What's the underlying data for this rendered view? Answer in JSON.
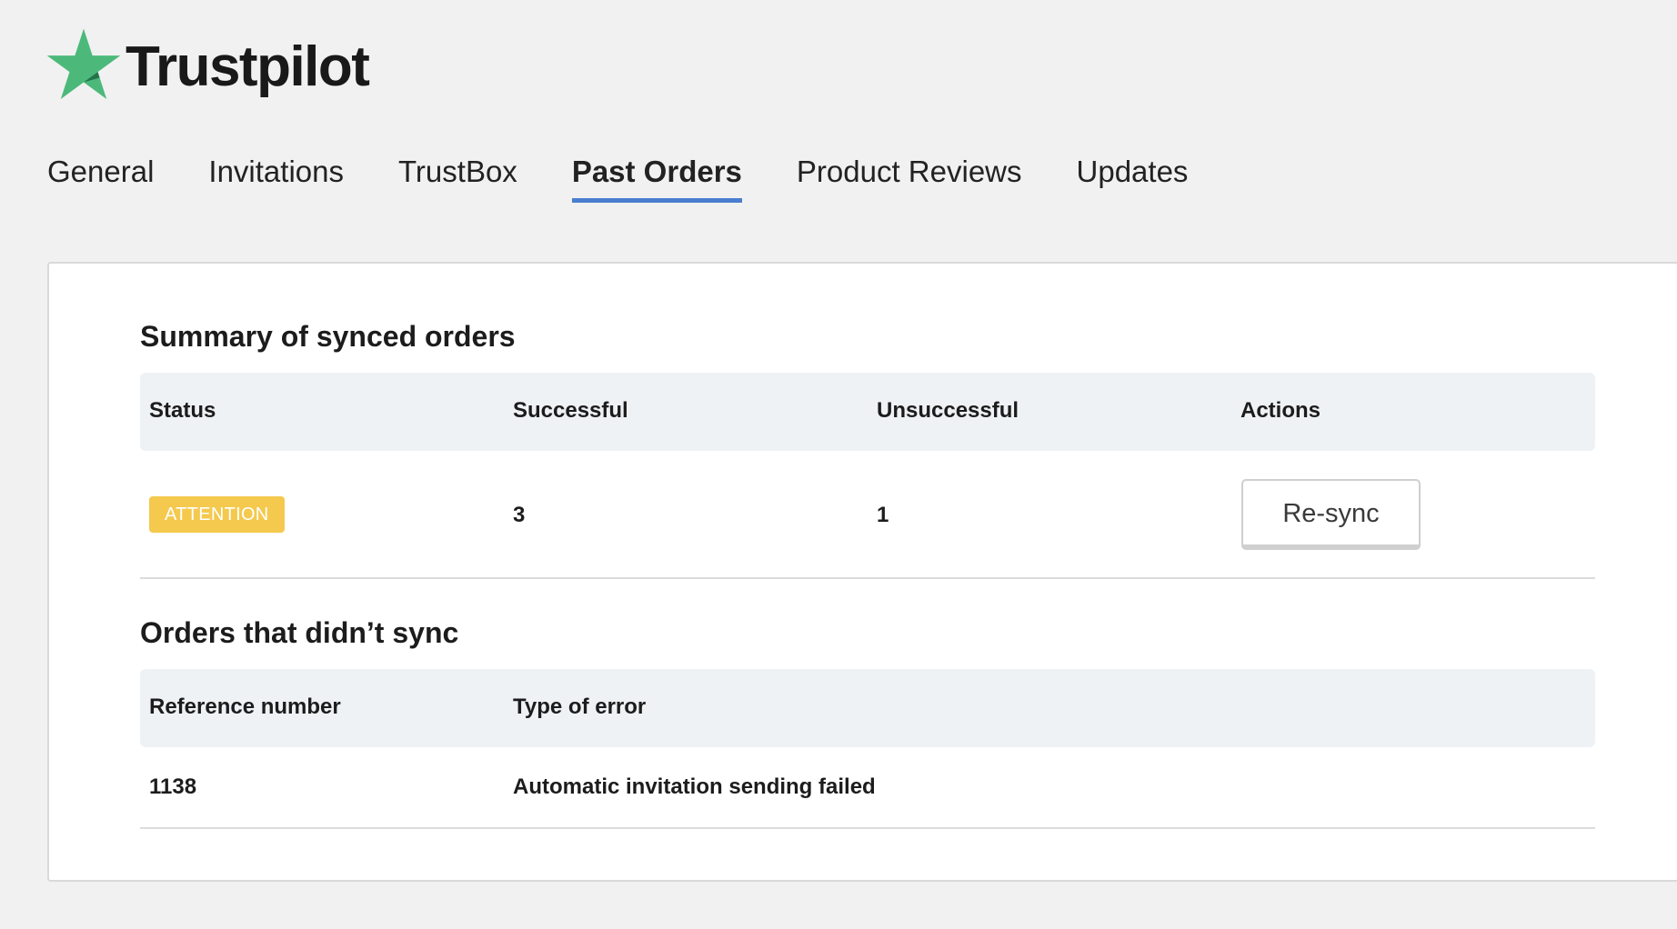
{
  "brand": {
    "name": "Trustpilot",
    "star_color": "#4cb97a"
  },
  "tabs": [
    {
      "label": "General",
      "active": false
    },
    {
      "label": "Invitations",
      "active": false
    },
    {
      "label": "TrustBox",
      "active": false
    },
    {
      "label": "Past Orders",
      "active": true
    },
    {
      "label": "Product Reviews",
      "active": false
    },
    {
      "label": "Updates",
      "active": false
    }
  ],
  "summary": {
    "title": "Summary of synced orders",
    "columns": [
      "Status",
      "Successful",
      "Unsuccessful",
      "Actions"
    ],
    "row": {
      "status": "ATTENTION",
      "successful": "3",
      "unsuccessful": "1",
      "action_label": "Re-sync"
    }
  },
  "failed": {
    "title": "Orders that didn’t sync",
    "columns": [
      "Reference number",
      "Type of error"
    ],
    "rows": [
      {
        "reference": "1138",
        "error": "Automatic invitation sending failed"
      }
    ]
  },
  "colors": {
    "accent": "#4b7ecf",
    "attention": "#f4c94e"
  }
}
